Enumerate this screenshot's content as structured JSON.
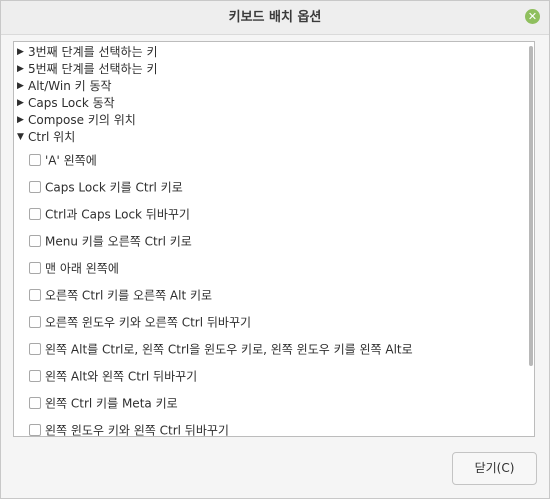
{
  "window": {
    "title": "키보드 배치 옵션",
    "close_glyph": "✕"
  },
  "groups": [
    {
      "label": "3번째 단계를 선택하는 키",
      "expanded": false
    },
    {
      "label": "5번째 단계를 선택하는 키",
      "expanded": false
    },
    {
      "label": "Alt/Win 키 동작",
      "expanded": false
    },
    {
      "label": "Caps Lock 동작",
      "expanded": false
    },
    {
      "label": "Compose 키의 위치",
      "expanded": false
    },
    {
      "label": "Ctrl 위치",
      "expanded": true
    }
  ],
  "options": [
    {
      "label": "'A' 왼쪽에",
      "checked": false
    },
    {
      "label": "Caps Lock 키를 Ctrl 키로",
      "checked": false
    },
    {
      "label": "Ctrl과 Caps Lock 뒤바꾸기",
      "checked": false
    },
    {
      "label": "Menu 키를 오른쪽 Ctrl 키로",
      "checked": false
    },
    {
      "label": "맨 아래 왼쪽에",
      "checked": false
    },
    {
      "label": "오른쪽 Ctrl 키를 오른쪽 Alt 키로",
      "checked": false
    },
    {
      "label": "오른쪽 윈도우 키와 오른쪽 Ctrl 뒤바꾸기",
      "checked": false
    },
    {
      "label": "왼쪽 Alt를 Ctrl로, 왼쪽 Ctrl을 윈도우 키로, 왼쪽 윈도우 키를 왼쪽 Alt로",
      "checked": false
    },
    {
      "label": "왼쪽 Alt와 왼쪽 Ctrl 뒤바꾸기",
      "checked": false
    },
    {
      "label": "왼쪽 Ctrl 키를 Meta 키로",
      "checked": false
    },
    {
      "label": "왼쪽 윈도우 키와 왼쪽 Ctrl 뒤바꾸기",
      "checked": false
    }
  ],
  "footer": {
    "close_button": "닫기(C)"
  },
  "colors": {
    "accent": "#8fbf5e"
  }
}
